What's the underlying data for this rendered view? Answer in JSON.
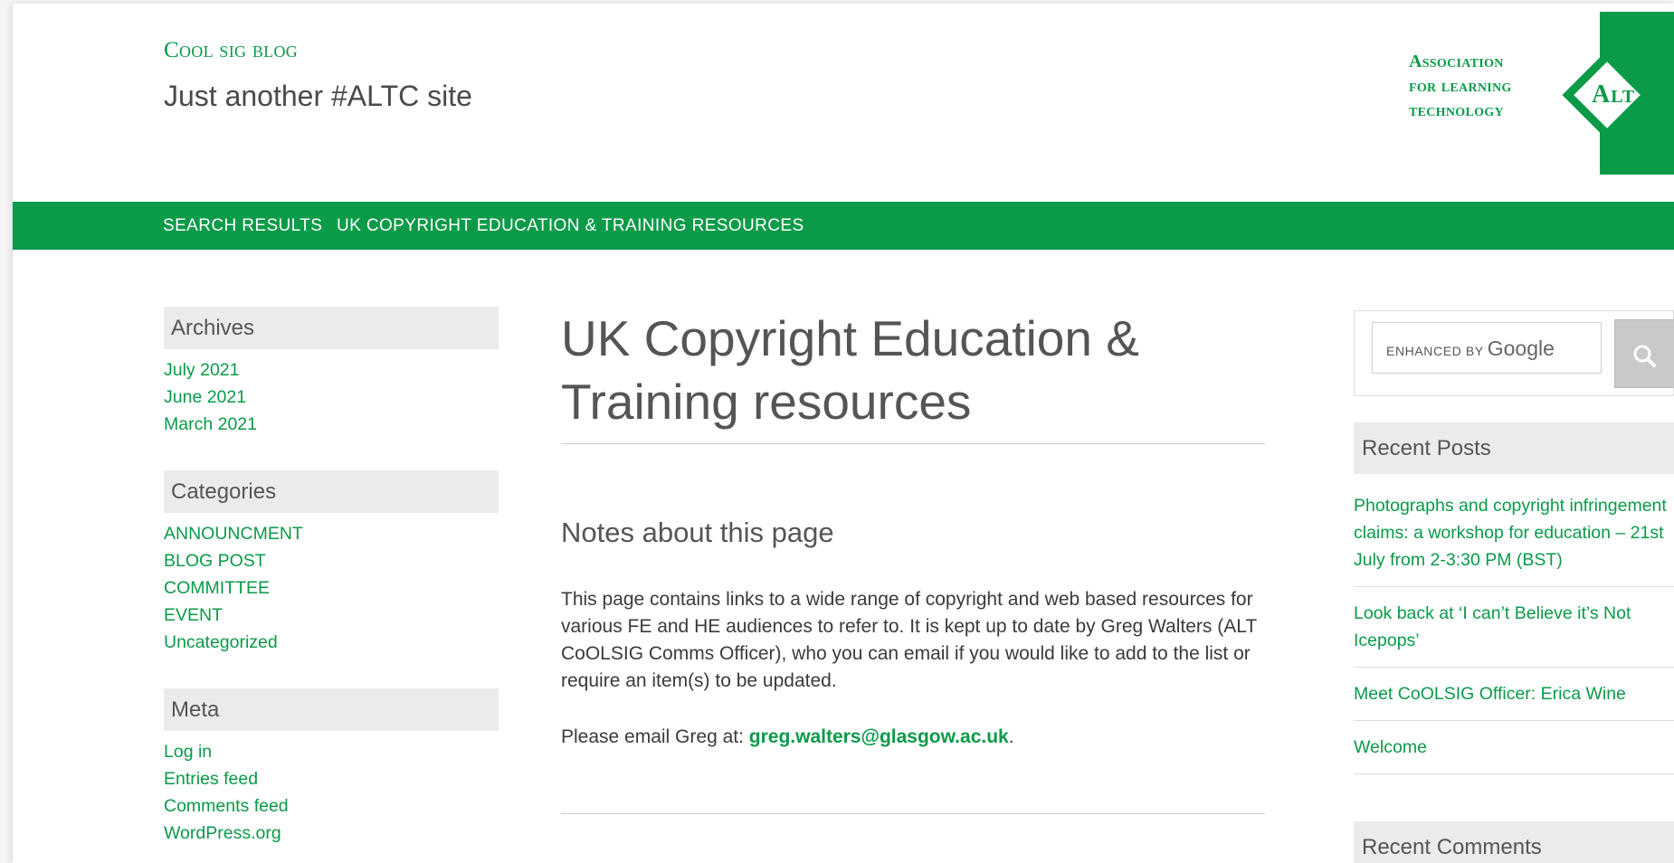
{
  "site": {
    "title": "Cool sig blog",
    "tagline": "Just another #ALTC site",
    "logo": {
      "lines": [
        "Association",
        "for learning",
        "technology"
      ],
      "mark": "Alt"
    }
  },
  "nav": {
    "items": [
      {
        "label": "SEARCH RESULTS"
      },
      {
        "label": "UK COPYRIGHT EDUCATION & TRAINING RESOURCES"
      }
    ]
  },
  "sidebar_left": {
    "archives": {
      "heading": "Archives",
      "items": [
        {
          "label": "July 2021"
        },
        {
          "label": "June 2021"
        },
        {
          "label": "March 2021"
        }
      ]
    },
    "categories": {
      "heading": "Categories",
      "items": [
        {
          "label": "ANNOUNCMENT"
        },
        {
          "label": "BLOG POST"
        },
        {
          "label": "COMMITTEE"
        },
        {
          "label": "EVENT"
        },
        {
          "label": "Uncategorized"
        }
      ]
    },
    "meta": {
      "heading": "Meta",
      "items": [
        {
          "label": "Log in"
        },
        {
          "label": "Entries feed"
        },
        {
          "label": "Comments feed"
        },
        {
          "label": "WordPress.org"
        }
      ]
    }
  },
  "main": {
    "title": "UK Copyright Education & Training resources",
    "subheading": "Notes about this page",
    "paragraph1": "This page contains links to a wide range of copyright and web based resources for various FE and HE audiences to refer to. It is kept up to date by Greg Walters (ALT CoOLSIG Comms Officer), who you can email if you would like to add to the list or require an item(s) to be updated.",
    "paragraph2_prefix": "Please email Greg at: ",
    "email": "greg.walters@glasgow.ac.uk",
    "paragraph2_suffix": "."
  },
  "sidebar_right": {
    "search": {
      "placeholder_prefix": "ENHANCED BY",
      "placeholder_brand": "Google",
      "button_icon": "search-icon"
    },
    "recent_posts": {
      "heading": "Recent Posts",
      "items": [
        {
          "label": "Photographs and copyright infringement claims: a workshop for education – 21st July from 2-3:30 PM (BST)"
        },
        {
          "label": "Look back at ‘I can’t Believe it’s Not Icepops’"
        },
        {
          "label": "Meet CoOLSIG Officer: Erica Wine"
        },
        {
          "label": "Welcome"
        }
      ]
    },
    "recent_comments": {
      "heading": "Recent Comments"
    }
  },
  "colors": {
    "brand_green": "#0a9a48",
    "widget_bg": "#ebebeb",
    "text_gray": "#555555"
  }
}
